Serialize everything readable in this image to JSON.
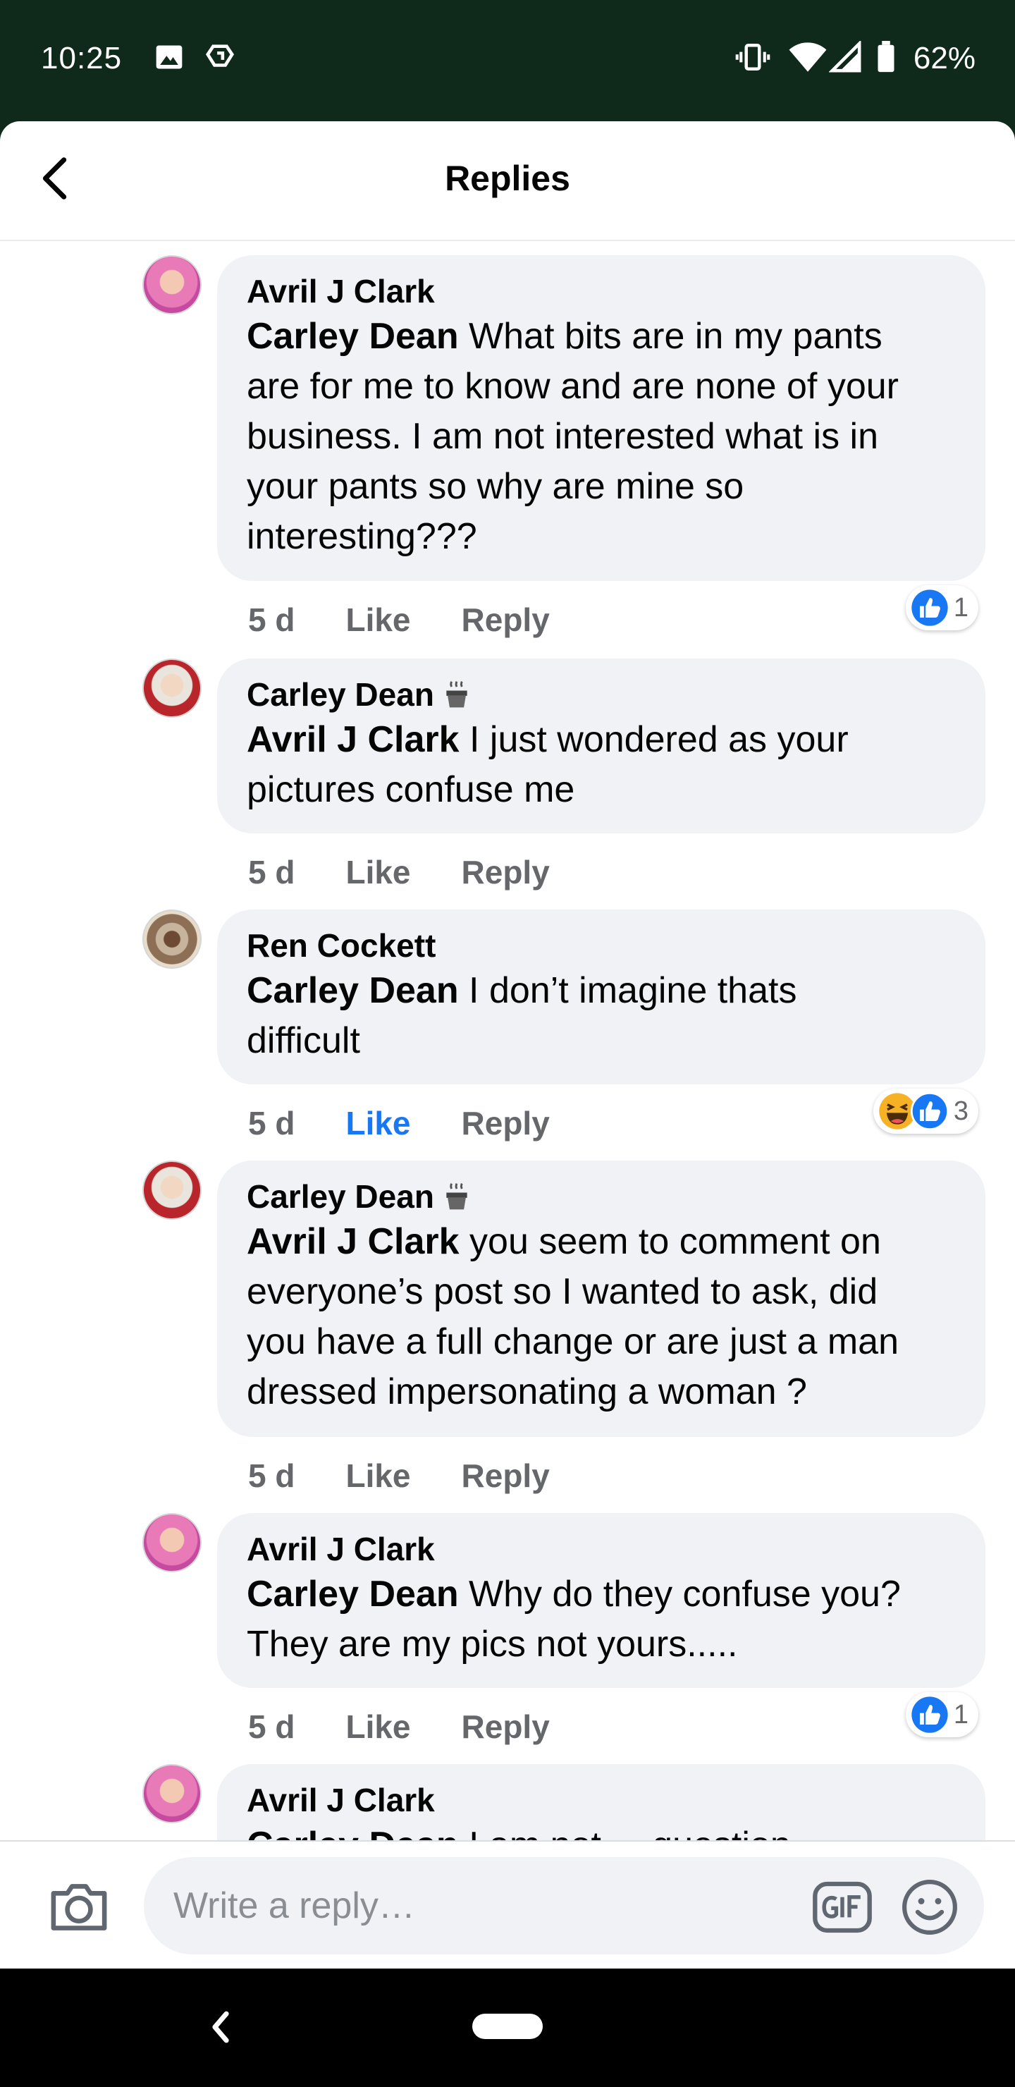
{
  "status_bar": {
    "time": "10:25",
    "battery": "62%"
  },
  "header": {
    "title": "Replies"
  },
  "comments": [
    {
      "author": "Avril J Clark",
      "mention": "Carley Dean",
      "text_lines": [
        " What bits are in my pants",
        "are for me to know and are none of your",
        "business. I am not interested what is in",
        "your pants so why are mine so",
        "interesting???"
      ],
      "time": "5 d",
      "like": "Like",
      "reply": "Reply",
      "reaction_count": "1"
    },
    {
      "author": "Carley Dean",
      "mention": "Avril J Clark",
      "text_lines": [
        " I just wondered as your",
        "pictures confuse me"
      ],
      "time": "5 d",
      "like": "Like",
      "reply": "Reply"
    },
    {
      "author": "Ren Cockett",
      "mention": "Carley Dean",
      "text_lines": [
        " I don’t imagine thats",
        "difficult"
      ],
      "time": "5 d",
      "like": "Like",
      "reply": "Reply",
      "reaction_count": "3"
    },
    {
      "author": "Carley Dean",
      "mention": "Avril J Clark",
      "text_lines": [
        " you seem to comment on",
        "everyone’s post so I wanted to ask, did",
        "you have a full change or are just a man",
        "dressed impersonating a woman ?"
      ],
      "time": "5 d",
      "like": "Like",
      "reply": "Reply"
    },
    {
      "author": "Avril J Clark",
      "mention": "Carley Dean",
      "text_lines": [
        " Why do they confuse you?",
        "They are my pics not yours....."
      ],
      "time": "5 d",
      "like": "Like",
      "reply": "Reply",
      "reaction_count": "1"
    },
    {
      "author": "Avril J Clark",
      "mention": "Carley Dean",
      "text_lines": [
        " I am not ... question"
      ]
    }
  ],
  "composer": {
    "placeholder": "Write a reply…"
  },
  "colors": {
    "status_bar_bg": "#0f2a1a",
    "bubble_bg": "#f0f2f5",
    "like_active": "#1877f2",
    "meta_gray": "#65676b"
  },
  "icons": [
    "image-icon",
    "recycle-icon",
    "vibrate-icon",
    "wifi-icon",
    "signal-icon",
    "battery-icon",
    "back-arrow-icon",
    "coffee-cup-icon",
    "like-reaction-icon",
    "laugh-reaction-icon",
    "camera-icon",
    "gif-icon",
    "emoji-icon"
  ]
}
